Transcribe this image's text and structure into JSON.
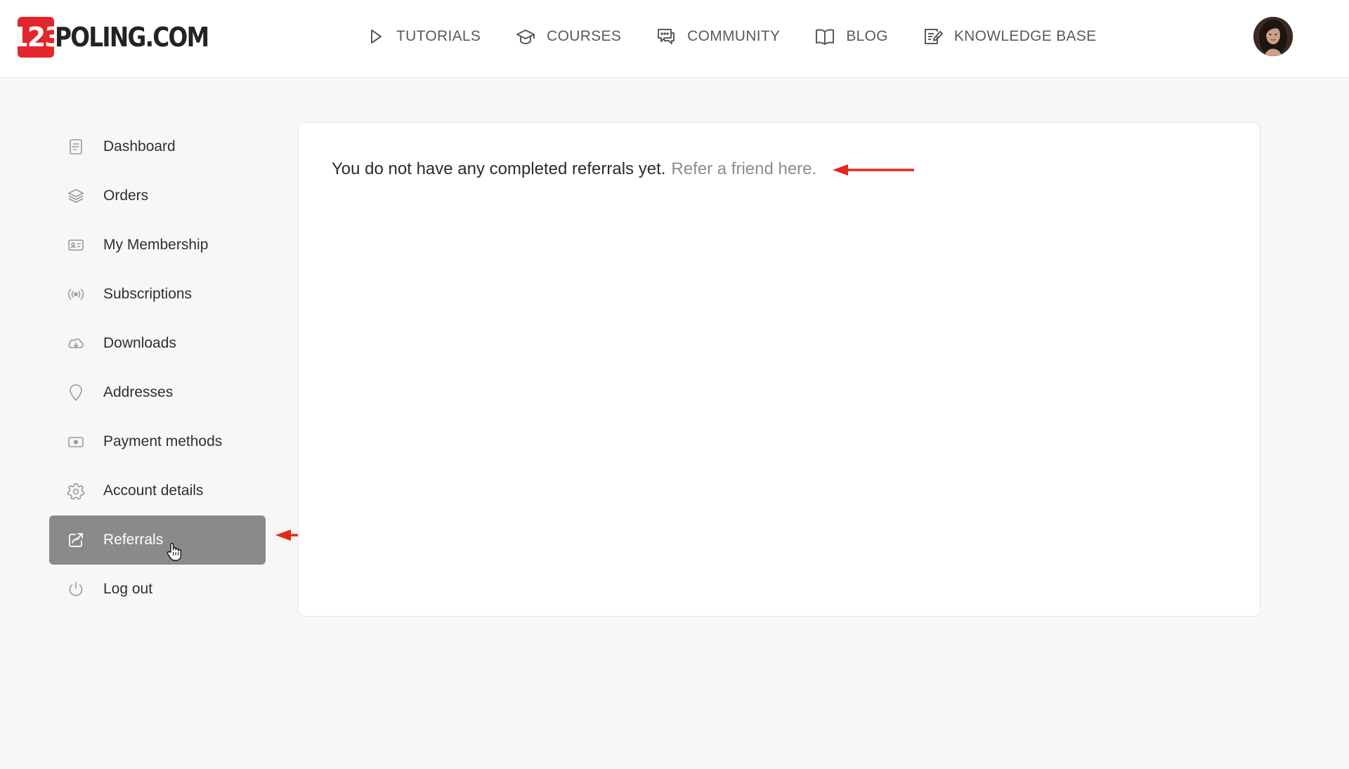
{
  "brand": {
    "badge": "123",
    "name": "POLING.COM",
    "accent_color": "#e3262b"
  },
  "nav": [
    {
      "label": "TUTORIALS",
      "icon": "play-icon"
    },
    {
      "label": "COURSES",
      "icon": "graduation-cap-icon"
    },
    {
      "label": "COMMUNITY",
      "icon": "chat-bubble-icon"
    },
    {
      "label": "BLOG",
      "icon": "open-book-icon"
    },
    {
      "label": "KNOWLEDGE BASE",
      "icon": "document-edit-icon"
    }
  ],
  "sidebar": {
    "items": [
      {
        "label": "Dashboard",
        "icon": "document-list-icon"
      },
      {
        "label": "Orders",
        "icon": "layers-icon"
      },
      {
        "label": "My Membership",
        "icon": "id-card-icon"
      },
      {
        "label": "Subscriptions",
        "icon": "broadcast-icon"
      },
      {
        "label": "Downloads",
        "icon": "cloud-download-icon"
      },
      {
        "label": "Addresses",
        "icon": "map-pin-icon"
      },
      {
        "label": "Payment methods",
        "icon": "money-icon"
      },
      {
        "label": "Account details",
        "icon": "gear-icon"
      },
      {
        "label": "Referrals",
        "icon": "share-icon",
        "active": true
      },
      {
        "label": "Log out",
        "icon": "power-icon"
      }
    ],
    "active_color": "#8a8a8a"
  },
  "referrals": {
    "message": "You do not have any completed referrals yet.",
    "link_label": "Refer a friend here."
  },
  "annotation_color": "#e02a1b"
}
